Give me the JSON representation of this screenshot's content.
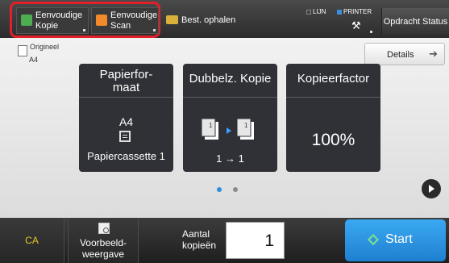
{
  "header": {
    "mode_buttons": [
      {
        "line1": "Eenvoudige",
        "line2": "Kopie"
      },
      {
        "line1": "Eenvoudige",
        "line2": "Scan"
      }
    ],
    "best_ophalen": "Best. ophalen",
    "lijn": "LIJN",
    "printer": "PRINTER",
    "status_button": "Opdracht Status"
  },
  "original": {
    "label": "Origineel",
    "size": "A4"
  },
  "details_button": "Details",
  "tiles": {
    "paper": {
      "title_line1": "Papierfor-",
      "title_line2": "maat",
      "size": "A4",
      "tray": "Papiercassette 1"
    },
    "duplex": {
      "title": "Dubbelz. Kopie",
      "icon_left_number": "1",
      "icon_right_number": "1",
      "value": "1 → 1"
    },
    "zoom": {
      "title": "Kopieerfactor",
      "value": "100%"
    }
  },
  "pager": {
    "pages": 2,
    "active": 1
  },
  "bottom": {
    "ca": "CA",
    "preview_line1": "Voorbeeld-",
    "preview_line2": "weergave",
    "copies_label_line1": "Aantal",
    "copies_label_line2": "kopieën",
    "copies_value": "1",
    "start": "Start"
  },
  "colors": {
    "highlight": "#e0202a",
    "start": "#2f93e6",
    "ca": "#e8c622",
    "accent_dot": "#2f8de0"
  }
}
